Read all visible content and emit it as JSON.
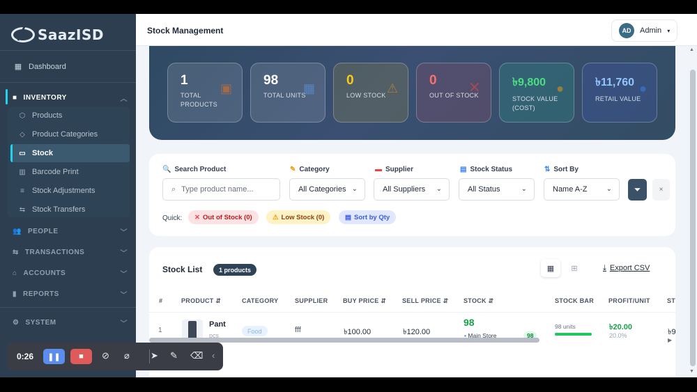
{
  "app": {
    "name": "SaazISD"
  },
  "sidebar": {
    "dashboard": "Dashboard",
    "inventory": {
      "label": "INVENTORY",
      "items": [
        {
          "label": "Products",
          "icon": "cube-icon"
        },
        {
          "label": "Product Categories",
          "icon": "tag-icon"
        },
        {
          "label": "Stock",
          "icon": "box-icon",
          "active": true
        },
        {
          "label": "Barcode Print",
          "icon": "barcode-icon"
        },
        {
          "label": "Stock Adjustments",
          "icon": "sliders-icon"
        },
        {
          "label": "Stock Transfers",
          "icon": "transfer-icon"
        }
      ]
    },
    "sections": [
      "PEOPLE",
      "TRANSACTIONS",
      "ACCOUNTS",
      "REPORTS",
      "SYSTEM"
    ]
  },
  "header": {
    "title": "Stock Management",
    "user_initials": "AD",
    "user_name": "Admin"
  },
  "stats": [
    {
      "value": "1",
      "label": "TOTAL PRODUCTS"
    },
    {
      "value": "98",
      "label": "TOTAL UNITS"
    },
    {
      "value": "0",
      "label": "LOW STOCK"
    },
    {
      "value": "0",
      "label": "OUT OF STOCK"
    },
    {
      "value": "৳9,800",
      "label": "STOCK VALUE (COST)"
    },
    {
      "value": "৳11,760",
      "label": "RETAIL VALUE"
    }
  ],
  "filters": {
    "search_label": "Search Product",
    "search_placeholder": "Type product name...",
    "category_label": "Category",
    "category_value": "All Categories",
    "supplier_label": "Supplier",
    "supplier_value": "All Suppliers",
    "status_label": "Stock Status",
    "status_value": "All Status",
    "sort_label": "Sort By",
    "sort_value": "Name A-Z",
    "clear": "×",
    "quick_label": "Quick:",
    "quick": [
      "Out of Stock (0)",
      "Low Stock (0)",
      "Sort by Qty"
    ]
  },
  "list": {
    "title": "Stock List",
    "count_badge": "1 products",
    "export": "Export CSV",
    "columns": [
      "#",
      "PRODUCT ⇵",
      "CATEGORY",
      "SUPPLIER",
      "BUY PRICE ⇵",
      "SELL PRICE ⇵",
      "STOCK ⇵",
      "STOCK BAR",
      "PROFIT/UNIT",
      "ST"
    ],
    "rows": [
      {
        "num": "1",
        "product": "Pant",
        "unit": "pcs",
        "category": "Food",
        "supplier": "fff",
        "buy_price": "৳100.00",
        "sell_price": "৳120.00",
        "stock": "98",
        "store": "Main Store",
        "store_qty": "98",
        "bar_label": "98 units",
        "bar_fill": 1.0,
        "profit": "৳20.00",
        "profit_pct": "20.0%",
        "extra": "৳9"
      }
    ]
  },
  "recorder": {
    "time": "0:26"
  },
  "colors": {
    "accent": "#22d3ee",
    "sidebar": "#2c3e50",
    "success": "#22c55e"
  }
}
